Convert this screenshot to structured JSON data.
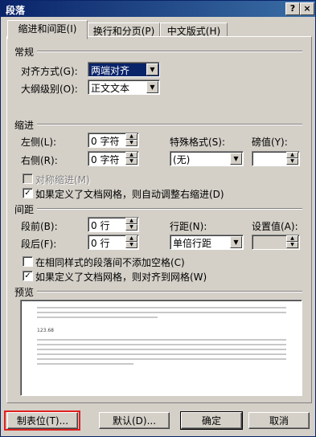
{
  "window": {
    "title": "段落"
  },
  "titlebar_buttons": [
    "?",
    "×"
  ],
  "tabs": [
    {
      "label": "缩进和间距(I)",
      "active": true
    },
    {
      "label": "换行和分页(P)",
      "active": false
    },
    {
      "label": "中文版式(H)",
      "active": false
    }
  ],
  "general": {
    "section": "常规",
    "alignment_label": "对齐方式(G):",
    "alignment_value": "两端对齐",
    "outline_label": "大纲级别(O):",
    "outline_value": "正文文本"
  },
  "indent": {
    "section": "缩进",
    "left_label": "左侧(L):",
    "left_value": "0 字符",
    "right_label": "右侧(R):",
    "right_value": "0 字符",
    "special_label": "特殊格式(S):",
    "special_value": "(无)",
    "by_label": "磅值(Y):",
    "by_value": "",
    "mirror_label": "对称缩进(M)",
    "mirror_checked": false,
    "auto_adjust_label": "如果定义了文档网格，则自动调整右缩进(D)",
    "auto_adjust_checked": true
  },
  "spacing": {
    "section": "间距",
    "before_label": "段前(B):",
    "before_value": "0 行",
    "after_label": "段后(F):",
    "after_value": "0 行",
    "line_spacing_label": "行距(N):",
    "line_spacing_value": "单倍行距",
    "at_label": "设置值(A):",
    "at_value": "",
    "no_space_label": "在相同样式的段落间不添加空格(C)",
    "no_space_checked": false,
    "snap_grid_label": "如果定义了文档网格，则对齐到网格(W)",
    "snap_grid_checked": true
  },
  "preview": {
    "section": "预览",
    "sample_number": "123.68"
  },
  "buttons": {
    "tabs": "制表位(T)...",
    "default": "默认(D)...",
    "ok": "确定",
    "cancel": "取消"
  }
}
